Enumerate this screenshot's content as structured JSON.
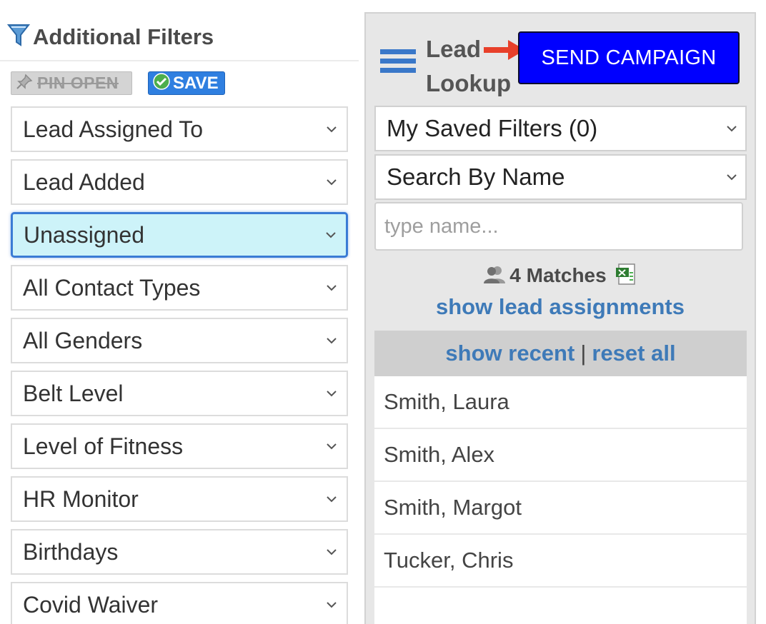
{
  "filters": {
    "title": "Additional Filters",
    "pin_label": "PIN OPEN",
    "save_label": "SAVE",
    "selects": [
      {
        "label": "Lead Assigned To"
      },
      {
        "label": "Lead Added"
      },
      {
        "label": "Unassigned"
      },
      {
        "label": "All Contact Types"
      },
      {
        "label": "All Genders"
      },
      {
        "label": "Belt Level"
      },
      {
        "label": "Level of Fitness"
      },
      {
        "label": "HR Monitor"
      },
      {
        "label": "Birthdays"
      },
      {
        "label": "Covid Waiver"
      }
    ]
  },
  "lookup": {
    "title": "Lead Lookup",
    "campaign_label": "SEND CAMPAIGN",
    "saved_filters": "My Saved Filters (0)",
    "search_by": "Search By Name",
    "search_placeholder": "type name...",
    "matches": "4 Matches",
    "show_assignments": "show lead assignments",
    "show_recent": "show recent",
    "separator": "|",
    "reset_all": "reset all",
    "results": [
      {
        "name": "Smith, Laura"
      },
      {
        "name": "Smith, Alex"
      },
      {
        "name": "Smith, Margot"
      },
      {
        "name": "Tucker, Chris"
      }
    ]
  },
  "colors": {
    "accent_blue": "#3e7ab8",
    "campaign_button": "#0000ff",
    "annotation_arrow": "#e8402a",
    "active_select_bg": "#cdf3f9"
  },
  "icons": {
    "filter": "funnel-icon",
    "pin": "pushpin-icon",
    "save": "checkmark-icon",
    "menu": "hamburger-icon",
    "matches": "users-icon",
    "export": "excel-icon",
    "dropdown": "chevron-down-icon"
  }
}
